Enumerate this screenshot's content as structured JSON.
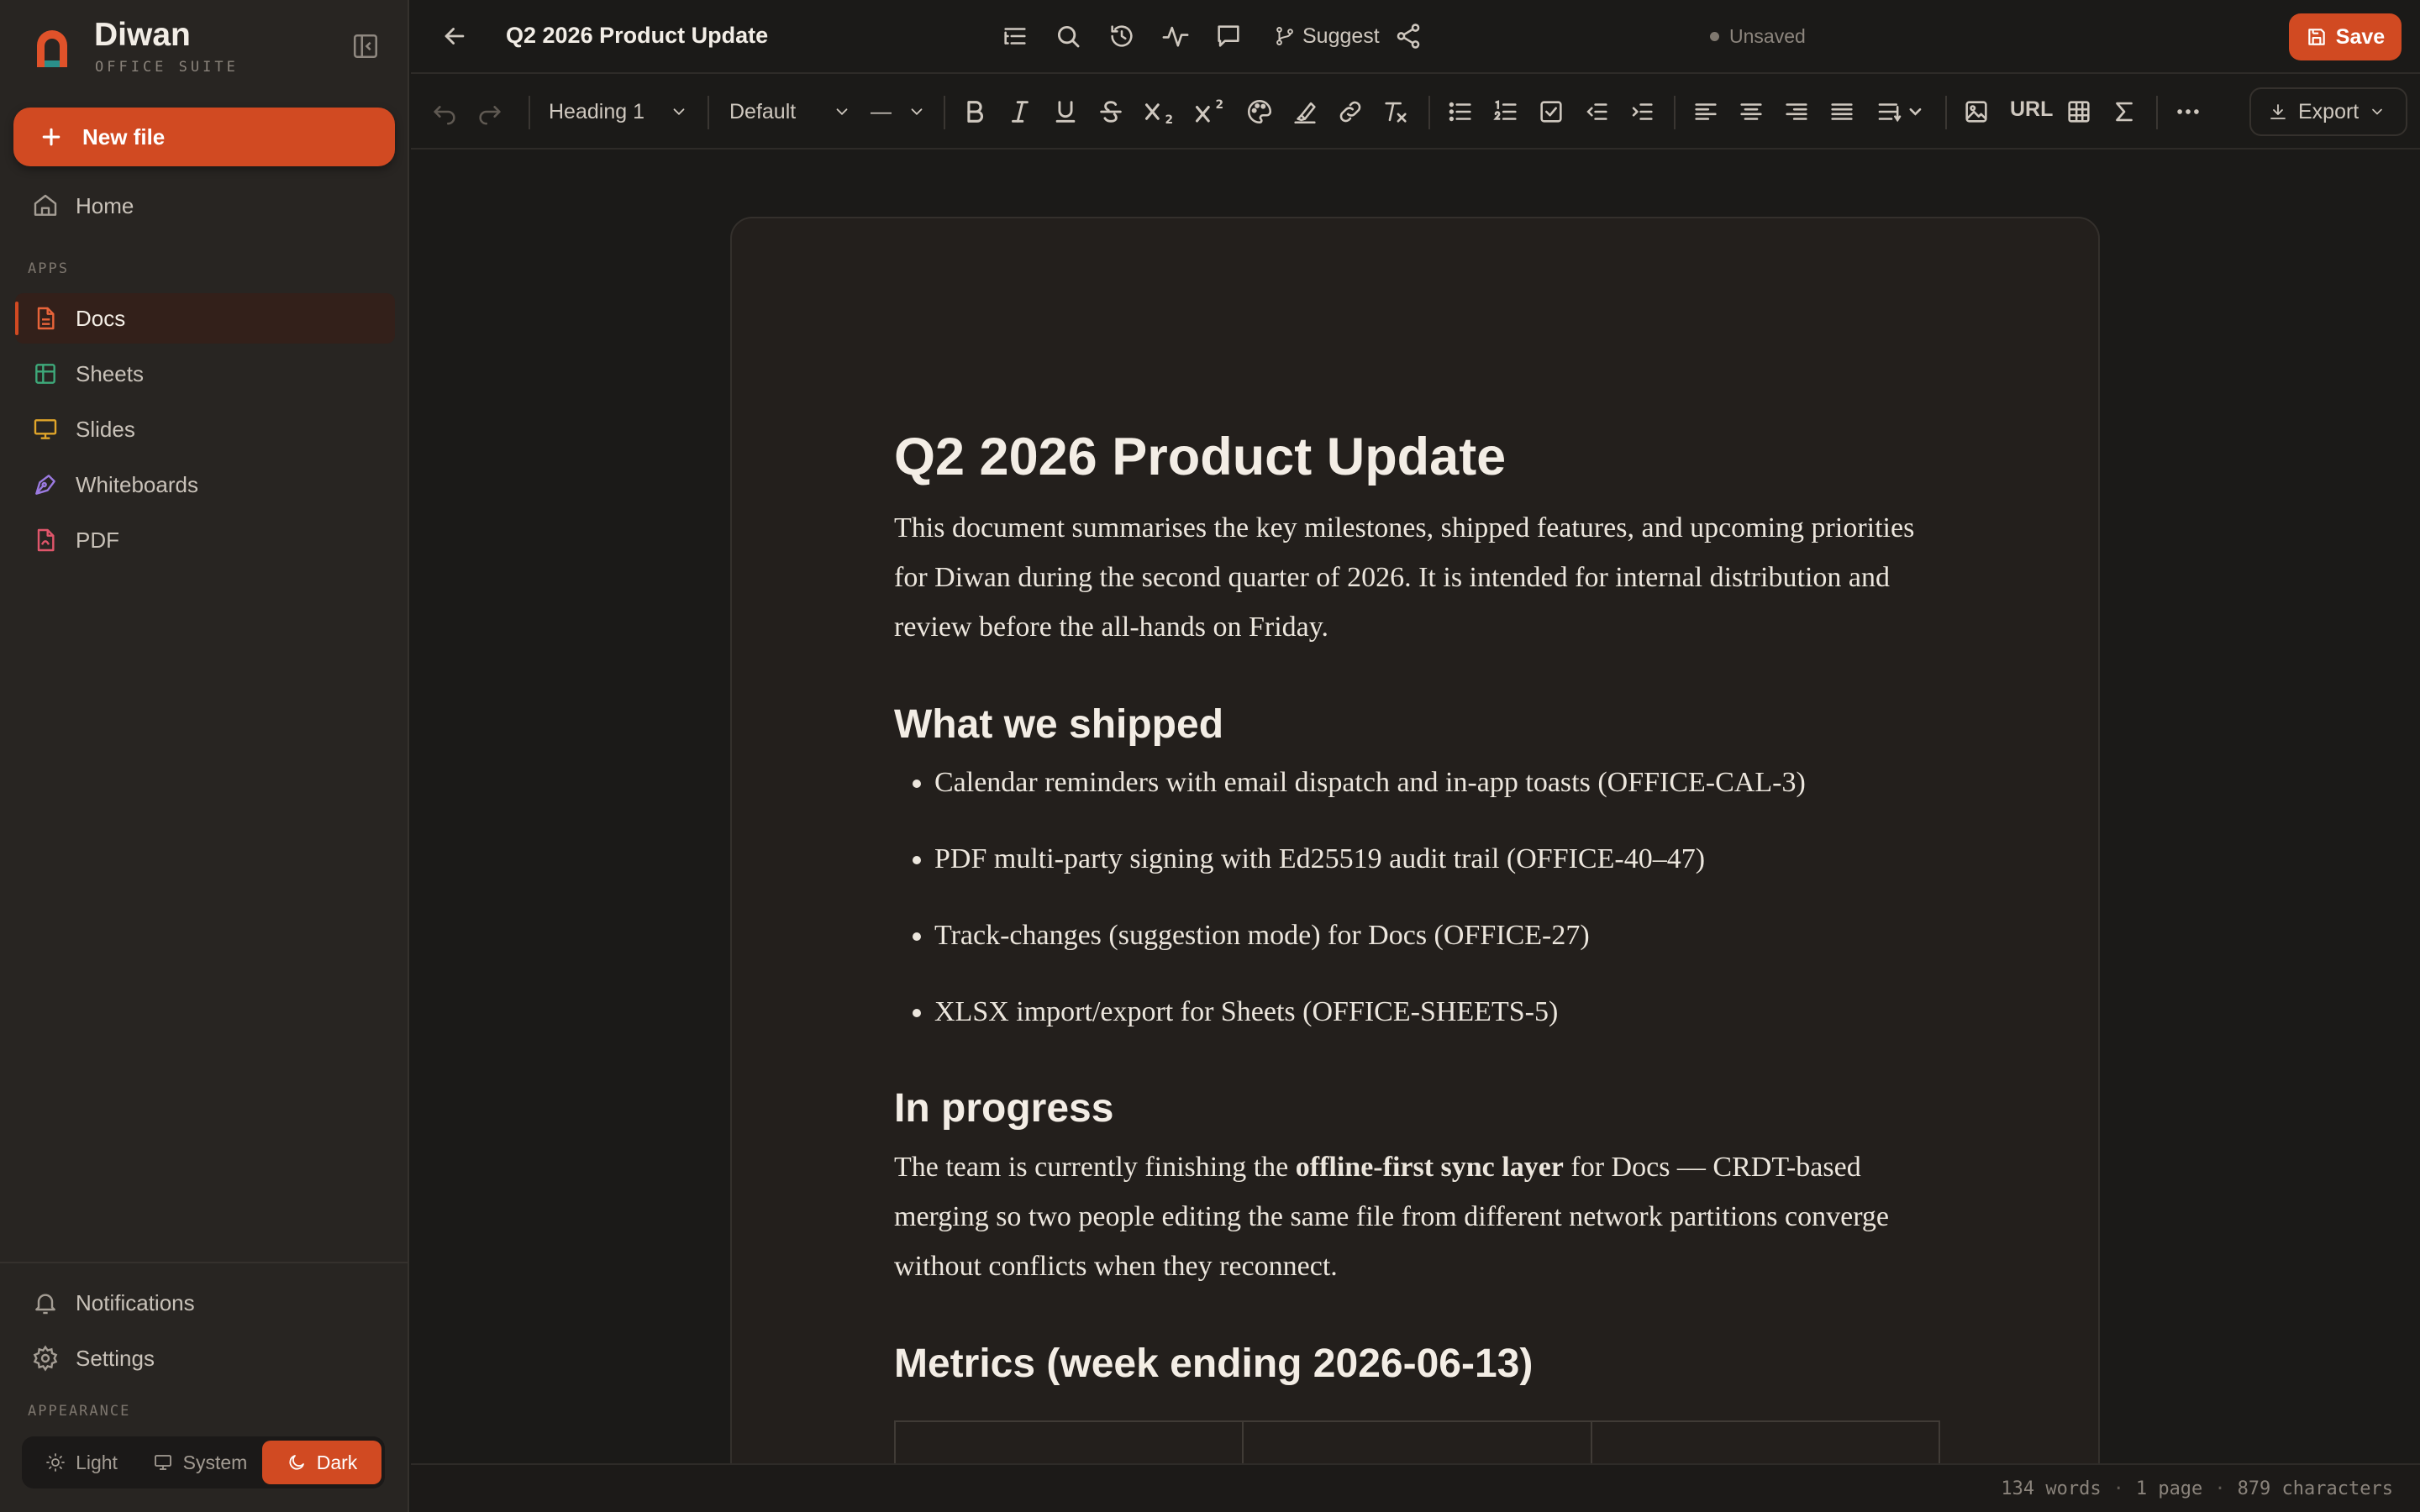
{
  "app": {
    "name": "Diwan",
    "subtitle": "OFFICE SUITE"
  },
  "sidebar": {
    "new_file": "New file",
    "home": "Home",
    "apps_label": "APPS",
    "items": [
      {
        "label": "Docs",
        "icon": "doc-icon",
        "color": "#e8643a",
        "active": true
      },
      {
        "label": "Sheets",
        "icon": "sheet-icon",
        "color": "#3ea97a"
      },
      {
        "label": "Slides",
        "icon": "slides-icon",
        "color": "#e0a52a"
      },
      {
        "label": "Whiteboards",
        "icon": "pen-tool-icon",
        "color": "#9b7ae0"
      },
      {
        "label": "PDF",
        "icon": "pdf-file-icon",
        "color": "#e0566b"
      }
    ],
    "notifications": "Notifications",
    "settings": "Settings",
    "appearance_label": "APPEARANCE",
    "theme": {
      "light": "Light",
      "system": "System",
      "dark": "Dark",
      "selected": "Dark"
    }
  },
  "topbar": {
    "title": "Q2 2026 Product Update",
    "status": "Unsaved",
    "suggest": "Suggest",
    "save": "Save"
  },
  "toolbar": {
    "block_style": "Heading 1",
    "font": "Default",
    "font_size": "—",
    "url": "URL",
    "export": "Export"
  },
  "document": {
    "title": "Q2 2026 Product Update",
    "intro": "This document summarises the key milestones, shipped features, and upcoming priorities for Diwan during the second quarter of 2026. It is intended for internal distribution and review before the all-hands on Friday.",
    "shipped_heading": "What we shipped",
    "shipped": [
      "Calendar reminders with email dispatch and in-app toasts (OFFICE-CAL-3)",
      "PDF multi-party signing with Ed25519 audit trail (OFFICE-40–47)",
      "Track-changes (suggestion mode) for Docs (OFFICE-27)",
      "XLSX import/export for Sheets (OFFICE-SHEETS-5)"
    ],
    "progress_heading": "In progress",
    "progress_before": "The team is currently finishing the ",
    "progress_bold": "offline-first sync layer",
    "progress_after": " for Docs — CRDT-based merging so two people editing the same file from different network partitions converge without conflicts when they reconnect.",
    "metrics_heading": "Metrics (week ending 2026-06-13)"
  },
  "statusbar": {
    "words": "134 words",
    "pages": "1 page",
    "characters": "879 characters"
  },
  "colors": {
    "accent": "#d14a22",
    "background": "#1b1a18",
    "sidebar": "#282522",
    "page": "#231f1c"
  }
}
